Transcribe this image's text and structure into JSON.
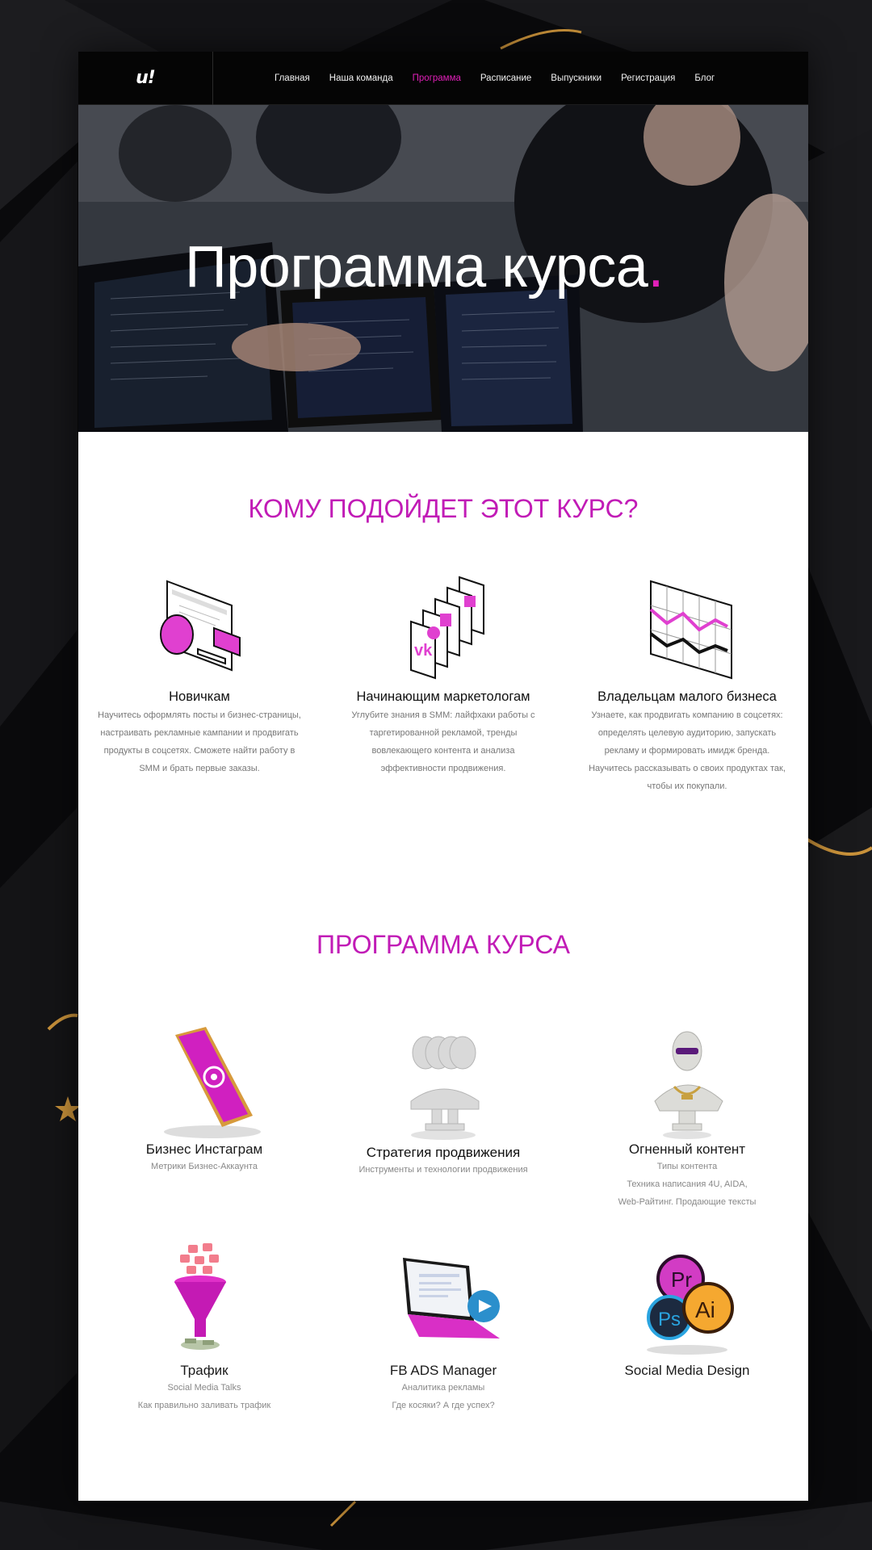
{
  "nav": {
    "logo": "u!",
    "items": [
      "Главная",
      "Наша команда",
      "Программа",
      "Расписание",
      "Выпускники",
      "Регистрация",
      "Блог"
    ],
    "active_index": 2
  },
  "hero": {
    "title": "Программа курса",
    "dot": "."
  },
  "audience": {
    "title": "КОМУ ПОДОЙДЕТ ЭТОТ КУРС?",
    "cards": [
      {
        "icon": "browser-window-icon",
        "title": "Новичкам",
        "text": "Научитесь оформлять посты и бизнес-страницы, настраивать рекламные кампании и продвигать продукты в соцсетях. Сможете найти работу в SMM и брать первые заказы."
      },
      {
        "icon": "social-cards-icon",
        "title": "Начинающим маркетологам",
        "text": "Углубите знания в SMM: лайфхаки работы с таргетированной рекламой, тренды вовлекающего контента и анализа эффективности продвижения."
      },
      {
        "icon": "chart-icon",
        "title": "Владельцам малого бизнеса",
        "text": "Узнаете, как продвигать компанию в соцсетях: определять целевую аудиторию, запускать рекламу и формировать имидж бренда. Научитесь рассказывать о своих продуктах так, чтобы их покупали."
      }
    ]
  },
  "program": {
    "title": "ПРОГРАММА КУРСА",
    "items": [
      {
        "icon": "instagram-phone-icon",
        "title": "Бизнес Инстаграм",
        "lines": [
          "Метрики Бизнес-Аккаунта"
        ]
      },
      {
        "icon": "statue-busts-icon",
        "title": "Стратегия продвижения",
        "lines": [
          "Инструменты и технологии продвижения"
        ]
      },
      {
        "icon": "statue-sunglasses-icon",
        "title": "Огненный контент",
        "lines": [
          "Типы контента",
          "Техника написания 4U, AIDA,",
          "Web-Райтинг. Продающие тексты"
        ]
      },
      {
        "icon": "funnel-icon",
        "title": "Трафик",
        "lines": [
          "Social Media Talks",
          "Как правильно заливать трафик"
        ]
      },
      {
        "icon": "laptop-icon",
        "title": "FB ADS Manager",
        "lines": [
          "Аналитика рекламы",
          "Где косяки? А где успех?"
        ]
      },
      {
        "icon": "adobe-apps-icon",
        "title": "Social Media Design",
        "lines": []
      }
    ]
  },
  "colors": {
    "accent": "#c11bb6",
    "nav_active": "#e020b8",
    "background": "#0b0b0d"
  }
}
